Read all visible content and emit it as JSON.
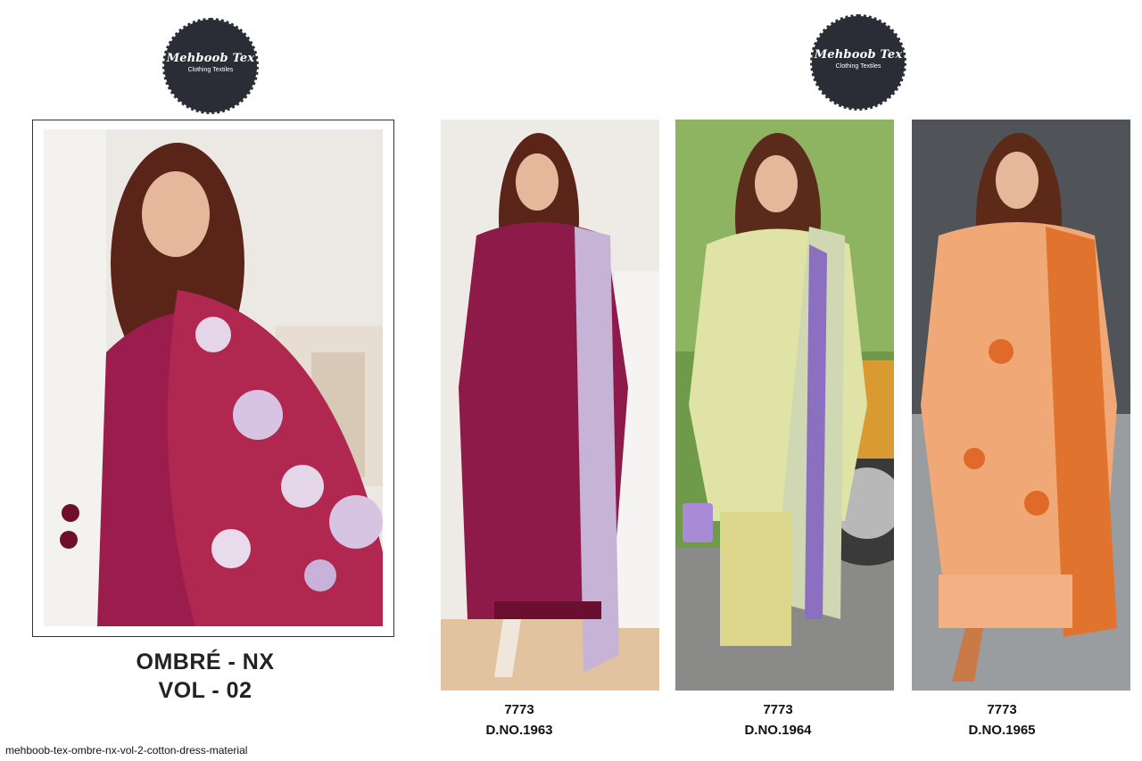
{
  "logos": [
    {
      "brand": "Mehboob Tex",
      "tagline": "Clothing Textiles"
    },
    {
      "brand": "Mehboob Tex",
      "tagline": "Clothing Textiles"
    }
  ],
  "catalog": {
    "title_line1": "OMBRÉ - NX",
    "title_line2": "VOL - 02"
  },
  "products": [
    {
      "code": "7773",
      "design_no": "D.NO.1963",
      "outfit_color": "#8e1a4a",
      "accent": "#e4d6e8"
    },
    {
      "code": "7773",
      "design_no": "D.NO.1964",
      "outfit_color": "#dfe3a6",
      "accent": "#8b6fc0"
    },
    {
      "code": "7773",
      "design_no": "D.NO.1965",
      "outfit_color": "#f0a877",
      "accent": "#e0732e"
    }
  ],
  "hero_outfit_color": "#9b1d4e",
  "filename": "mehboob-tex-ombre-nx-vol-2-cotton-dress-material"
}
